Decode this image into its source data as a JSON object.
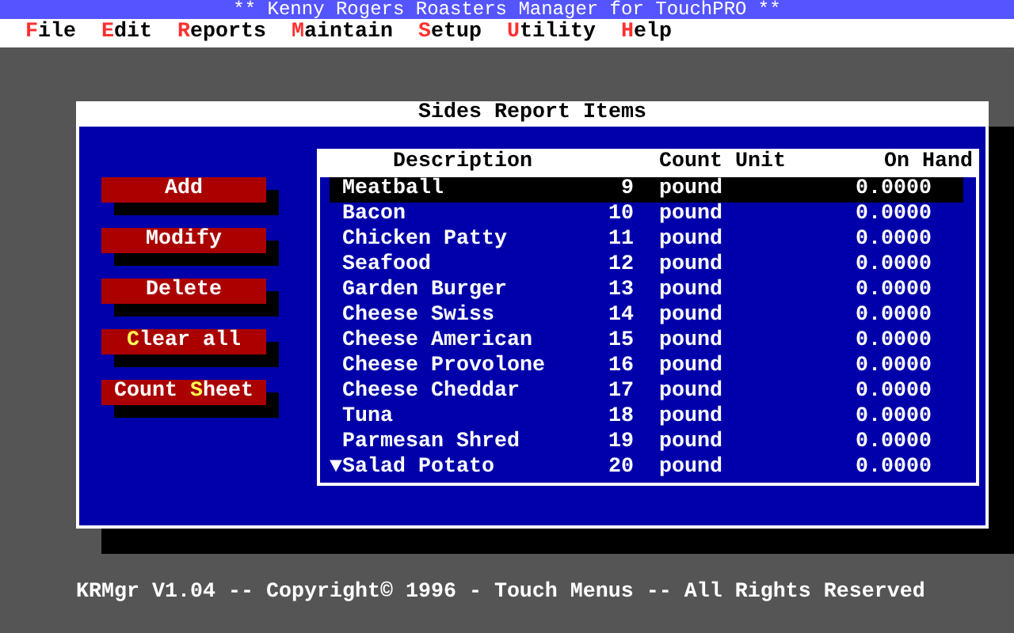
{
  "title_bar": {
    "title": "** Kenny Rogers Roasters Manager for TouchPRO **"
  },
  "menu": [
    {
      "key": "F",
      "post": "ile"
    },
    {
      "key": "E",
      "post": "dit"
    },
    {
      "key": "R",
      "post": "eports"
    },
    {
      "key": "M",
      "post": "aintain"
    },
    {
      "key": "S",
      "post": "etup"
    },
    {
      "key": "U",
      "post": "tility"
    },
    {
      "key": "H",
      "post": "elp"
    }
  ],
  "dialog": {
    "title": "Sides Report Items",
    "buttons": [
      {
        "pre": "Add"
      },
      {
        "pre": "Modify"
      },
      {
        "pre": "Delete"
      },
      {
        "key": "C",
        "post": "lear all"
      },
      {
        "pre": "Count ",
        "key": "S",
        "post": "heet"
      }
    ],
    "list": {
      "columns": [
        "Description",
        "Count Unit",
        "On Hand"
      ],
      "rows": [
        {
          "description": "Meatball",
          "count": "9",
          "unit": "pound",
          "on_hand": "0.0000",
          "selected": true
        },
        {
          "description": "Bacon",
          "count": "10",
          "unit": "pound",
          "on_hand": "0.0000",
          "selected": false
        },
        {
          "description": "Chicken Patty",
          "count": "11",
          "unit": "pound",
          "on_hand": "0.0000",
          "selected": false
        },
        {
          "description": "Seafood",
          "count": "12",
          "unit": "pound",
          "on_hand": "0.0000",
          "selected": false
        },
        {
          "description": "Garden Burger",
          "count": "13",
          "unit": "pound",
          "on_hand": "0.0000",
          "selected": false
        },
        {
          "description": "Cheese Swiss",
          "count": "14",
          "unit": "pound",
          "on_hand": "0.0000",
          "selected": false
        },
        {
          "description": "Cheese American",
          "count": "15",
          "unit": "pound",
          "on_hand": "0.0000",
          "selected": false
        },
        {
          "description": "Cheese Provolone",
          "count": "16",
          "unit": "pound",
          "on_hand": "0.0000",
          "selected": false
        },
        {
          "description": "Cheese Cheddar",
          "count": "17",
          "unit": "pound",
          "on_hand": "0.0000",
          "selected": false
        },
        {
          "description": "Tuna",
          "count": "18",
          "unit": "pound",
          "on_hand": "0.0000",
          "selected": false
        },
        {
          "description": "Parmesan Shred",
          "count": "19",
          "unit": "pound",
          "on_hand": "0.0000",
          "selected": false
        },
        {
          "marker": "▼",
          "description": "Salad Potato",
          "count": "20",
          "unit": "pound",
          "on_hand": "0.0000",
          "selected": false
        }
      ]
    }
  },
  "status_line": "KRMgr V1.04 -- Copyright© 1996 - Touch Menus -- All Rights Reserved"
}
